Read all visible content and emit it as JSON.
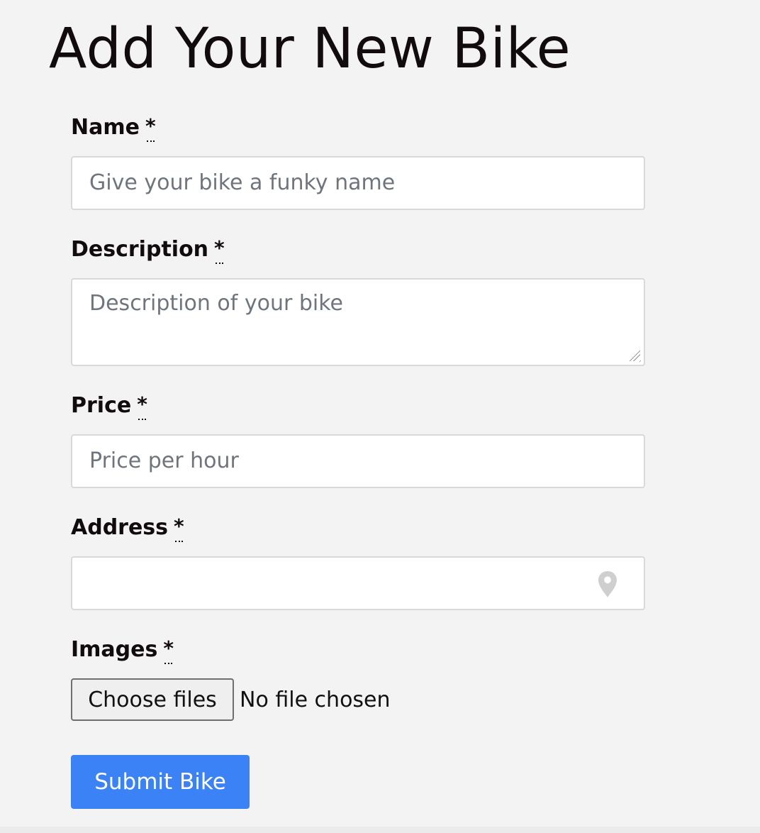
{
  "form": {
    "title": "Add Your New Bike",
    "fields": {
      "name": {
        "label": "Name",
        "required_marker": "*",
        "placeholder": "Give your bike a funky name"
      },
      "description": {
        "label": "Description",
        "required_marker": "*",
        "placeholder": "Description of your bike"
      },
      "price": {
        "label": "Price",
        "required_marker": "*",
        "placeholder": "Price per hour"
      },
      "address": {
        "label": "Address",
        "required_marker": "*",
        "placeholder": "",
        "icon": "location-pin-icon"
      },
      "images": {
        "label": "Images",
        "required_marker": "*",
        "button_label": "Choose files",
        "status_text": "No file chosen"
      }
    },
    "submit_label": "Submit Bike"
  },
  "colors": {
    "background": "#f3f3f3",
    "primary": "#3b82f6",
    "text": "#120b0d",
    "placeholder": "#6f757d",
    "border": "#d9d9d9"
  }
}
